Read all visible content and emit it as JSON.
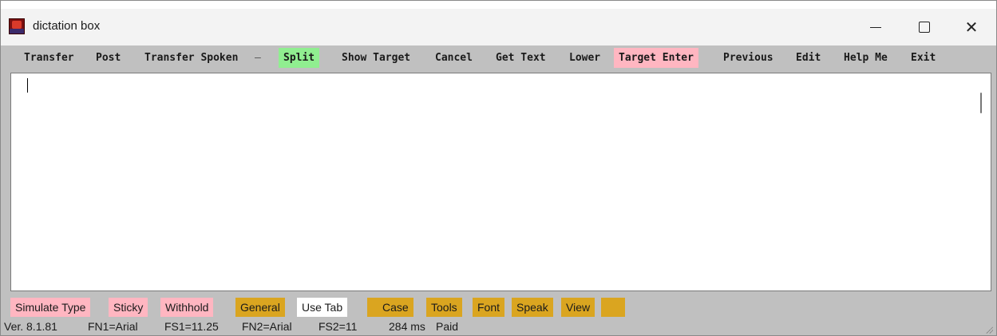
{
  "window": {
    "title": "dictation box",
    "icon": "app-icon",
    "controls": {
      "minimize_icon": "minimize-icon",
      "maximize_icon": "maximize-icon",
      "close_icon": "close-icon",
      "close_glyph": "✕"
    }
  },
  "toolbar": {
    "transfer": "Transfer",
    "post": "Post",
    "transfer_spoken": "Transfer Spoken",
    "separator": "—",
    "split": "Split",
    "show_target": "Show Target",
    "cancel": "Cancel",
    "get_text": "Get Text",
    "lower": "Lower",
    "target_enter": "Target Enter",
    "previous": "Previous",
    "edit": "Edit",
    "help_me": "Help Me",
    "exit": "Exit"
  },
  "editor": {
    "content": ""
  },
  "bottom_bar": {
    "simulate_type": "Simulate Type",
    "sticky": "Sticky",
    "withhold": "Withhold",
    "general": "General",
    "use_tab": "Use Tab",
    "case": "Case",
    "tools": "Tools",
    "font": "Font",
    "speak": "Speak",
    "view": "View"
  },
  "status_bar": {
    "version": "Ver. 8.1.81",
    "fn1": "FN1=Arial",
    "fs1": "FS1=11.25",
    "fn2": "FN2=Arial",
    "fs2": "FS2=11",
    "latency": "284 ms",
    "license": "Paid"
  },
  "colors": {
    "toolbar_bg": "#c0c0c0",
    "split_bg": "#90ee90",
    "target_enter_bg": "#ffb6c1",
    "pink_option_bg": "#ffb6c1",
    "gold_tab_bg": "#daa520",
    "active_tab_bg": "#ffffff"
  }
}
